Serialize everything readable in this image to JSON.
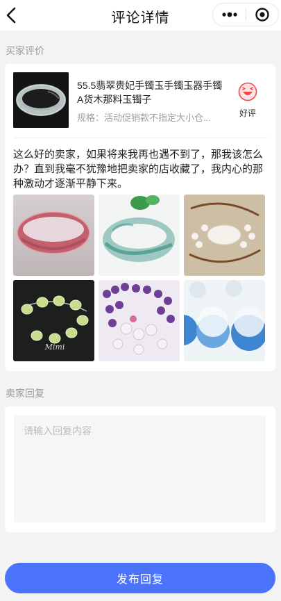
{
  "header": {
    "title": "评论详情",
    "back_icon": "chevron-left-icon",
    "more_icon": "more-dots-icon",
    "close_icon": "target-circle-icon"
  },
  "buyer_review": {
    "section_label": "买家评价",
    "product": {
      "name": "55.5翡翠贵妃手镯玉手镯玉器手镯A货木那料玉镯子",
      "spec": "规格：活动促销款不指定大小仓..."
    },
    "rating": {
      "label": "好评",
      "icon": "laughing-face-icon",
      "color": "#f04a4a"
    },
    "comment": "这么好的卖家，如果将来我再也遇不到了，那我该怎么办？直到我毫不犹豫地把卖家的店收藏了，我内心的那种激动才逐渐平静下来。",
    "photos": [
      {
        "alt": "红发晶手镯"
      },
      {
        "alt": "飘花玉镯"
      },
      {
        "alt": "白玉貔貅手链"
      },
      {
        "alt": "葡萄石手链"
      },
      {
        "alt": "紫水晶多圈手链"
      },
      {
        "alt": "蓝色陶瓷珠"
      }
    ]
  },
  "seller_reply": {
    "section_label": "卖家回复",
    "placeholder": "请输入回复内容",
    "value": ""
  },
  "submit": {
    "label": "发布回复",
    "color": "#4b73fb"
  }
}
